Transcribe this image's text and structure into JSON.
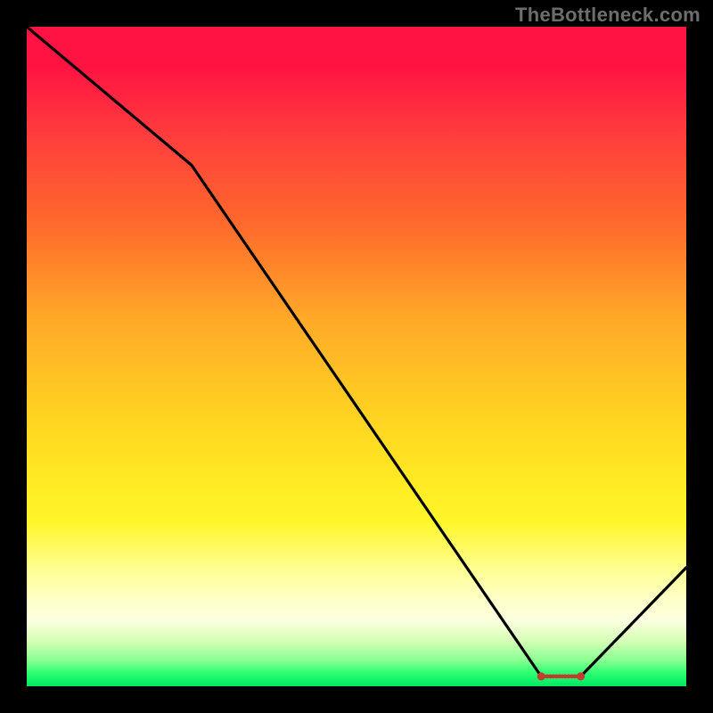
{
  "watermark": "TheBottleneck.com",
  "chart_data": {
    "type": "line",
    "title": "",
    "xlabel": "",
    "ylabel": "",
    "xlim": [
      0,
      100
    ],
    "ylim": [
      0,
      100
    ],
    "grid": false,
    "legend": false,
    "annotations": [],
    "series": [
      {
        "name": "curve",
        "color": "#000000",
        "x": [
          0,
          25,
          78,
          84,
          100
        ],
        "y": [
          100,
          79,
          1.5,
          1.5,
          18
        ]
      }
    ],
    "flat_segment": {
      "color": "#c63b2f",
      "x_start": 78,
      "x_end": 84,
      "y": 1.5,
      "dot_count": 14
    },
    "background_gradient": {
      "top": "#ff1343",
      "mid1": "#ffa829",
      "mid2": "#fff62a",
      "bottom": "#00e765"
    }
  }
}
